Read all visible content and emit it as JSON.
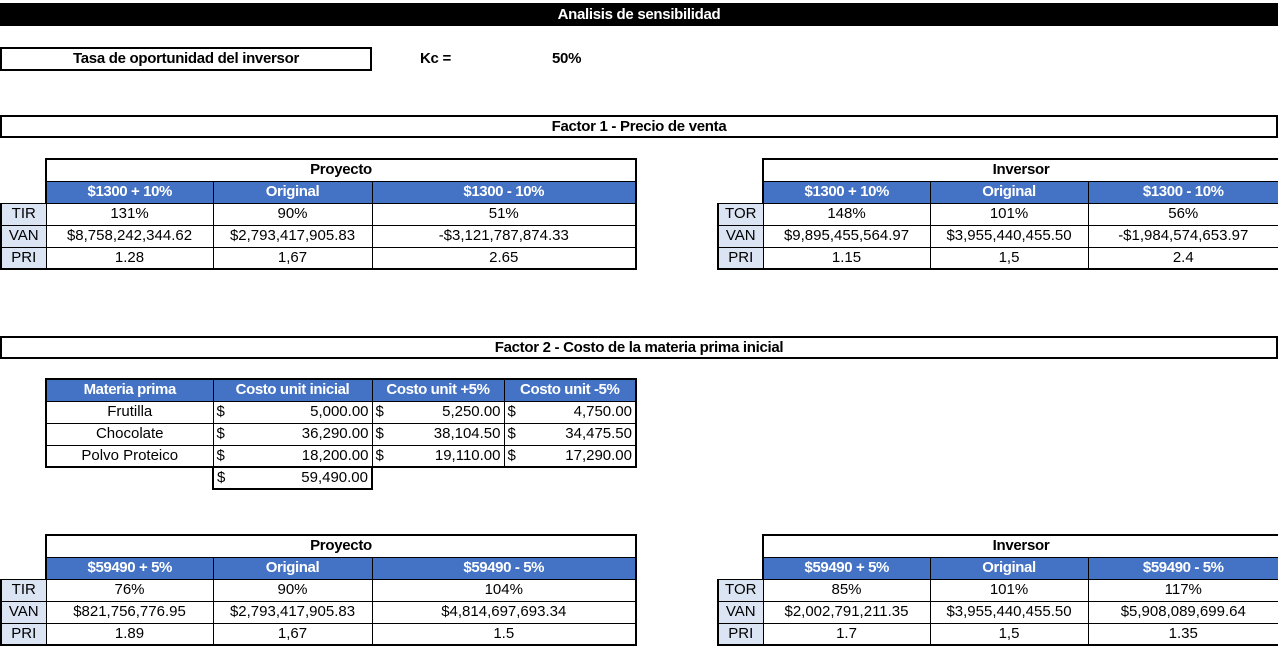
{
  "title": "Analisis de sensibilidad",
  "investor_rate": {
    "label": "Tasa de oportunidad del inversor",
    "kc_label": "Kc =",
    "kc_value": "50%"
  },
  "factor1": {
    "title": "Factor 1 - Precio de venta",
    "proyecto": {
      "title": "Proyecto",
      "columns": [
        "$1300 + 10%",
        "Original",
        "$1300 - 10%"
      ],
      "rows": [
        {
          "label": "TIR",
          "values": [
            "131%",
            "90%",
            "51%"
          ]
        },
        {
          "label": "VAN",
          "values": [
            "$8,758,242,344.62",
            "$2,793,417,905.83",
            "-$3,121,787,874.33"
          ]
        },
        {
          "label": "PRI",
          "values": [
            "1.28",
            "1,67",
            "2.65"
          ]
        }
      ]
    },
    "inversor": {
      "title": "Inversor",
      "columns": [
        "$1300 + 10%",
        "Original",
        "$1300 - 10%"
      ],
      "rows": [
        {
          "label": "TOR",
          "values": [
            "148%",
            "101%",
            "56%"
          ]
        },
        {
          "label": "VAN",
          "values": [
            "$9,895,455,564.97",
            "$3,955,440,455.50",
            "-$1,984,574,653.97"
          ]
        },
        {
          "label": "PRI",
          "values": [
            "1.15",
            "1,5",
            "2.4"
          ]
        }
      ]
    }
  },
  "factor2": {
    "title": "Factor 2 - Costo de la materia prima inicial",
    "materials": {
      "columns": [
        "Materia prima",
        "Costo unit inicial",
        "Costo unit +5%",
        "Costo unit -5%"
      ],
      "currency": "$",
      "rows": [
        {
          "name": "Frutilla",
          "values": [
            "5,000.00",
            "5,250.00",
            "4,750.00"
          ]
        },
        {
          "name": "Chocolate",
          "values": [
            "36,290.00",
            "38,104.50",
            "34,475.50"
          ]
        },
        {
          "name": "Polvo Proteico",
          "values": [
            "18,200.00",
            "19,110.00",
            "17,290.00"
          ]
        }
      ],
      "total": "59,490.00"
    },
    "proyecto": {
      "title": "Proyecto",
      "columns": [
        "$59490 + 5%",
        "Original",
        "$59490 - 5%"
      ],
      "rows": [
        {
          "label": "TIR",
          "values": [
            "76%",
            "90%",
            "104%"
          ]
        },
        {
          "label": "VAN",
          "values": [
            "$821,756,776.95",
            "$2,793,417,905.83",
            "$4,814,697,693.34"
          ]
        },
        {
          "label": "PRI",
          "values": [
            "1.89",
            "1,67",
            "1.5"
          ]
        }
      ]
    },
    "inversor": {
      "title": "Inversor",
      "columns": [
        "$59490 + 5%",
        "Original",
        "$59490 - 5%"
      ],
      "rows": [
        {
          "label": "TOR",
          "values": [
            "85%",
            "101%",
            "117%"
          ]
        },
        {
          "label": "VAN",
          "values": [
            "$2,002,791,211.35",
            "$3,955,440,455.50",
            "$5,908,089,699.64"
          ]
        },
        {
          "label": "PRI",
          "values": [
            "1.7",
            "1,5",
            "1.35"
          ]
        }
      ]
    }
  }
}
